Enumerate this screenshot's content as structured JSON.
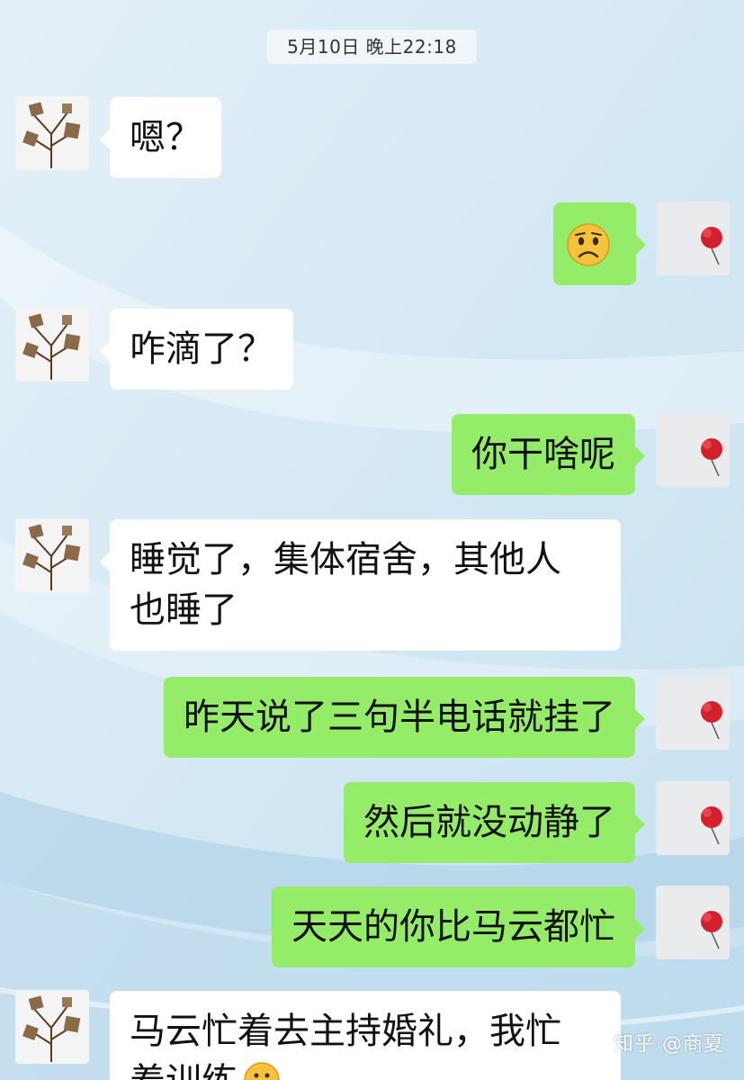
{
  "chat": {
    "timestamp": "5月10日 晚上22:18",
    "messages": [
      {
        "side": "left",
        "lines": [
          "嗯？"
        ]
      },
      {
        "side": "right",
        "emoji": "frowning-face"
      },
      {
        "side": "left",
        "lines": [
          "咋滴了？"
        ]
      },
      {
        "side": "right",
        "lines": [
          "你干啥呢"
        ]
      },
      {
        "side": "left",
        "lines": [
          "睡觉了，集体宿舍，其他人",
          "也睡了"
        ]
      },
      {
        "side": "right",
        "lines": [
          "昨天说了三句半电话就挂了"
        ]
      },
      {
        "side": "right",
        "lines": [
          "然后就没动静了"
        ]
      },
      {
        "side": "right",
        "lines": [
          "天天的你比马云都忙"
        ]
      },
      {
        "side": "left",
        "lines": [
          "马云忙着去主持婚礼，我忙",
          "着训练"
        ],
        "emoji": "grinning-face"
      }
    ]
  },
  "avatars": {
    "left_icon": "cotton-branch-icon",
    "right_icon": "red-flower-icon"
  },
  "colors": {
    "sent_bubble": "#95ec69",
    "received_bubble": "#ffffff",
    "background": "#dcecf6"
  },
  "watermark": "知乎 @商夏"
}
